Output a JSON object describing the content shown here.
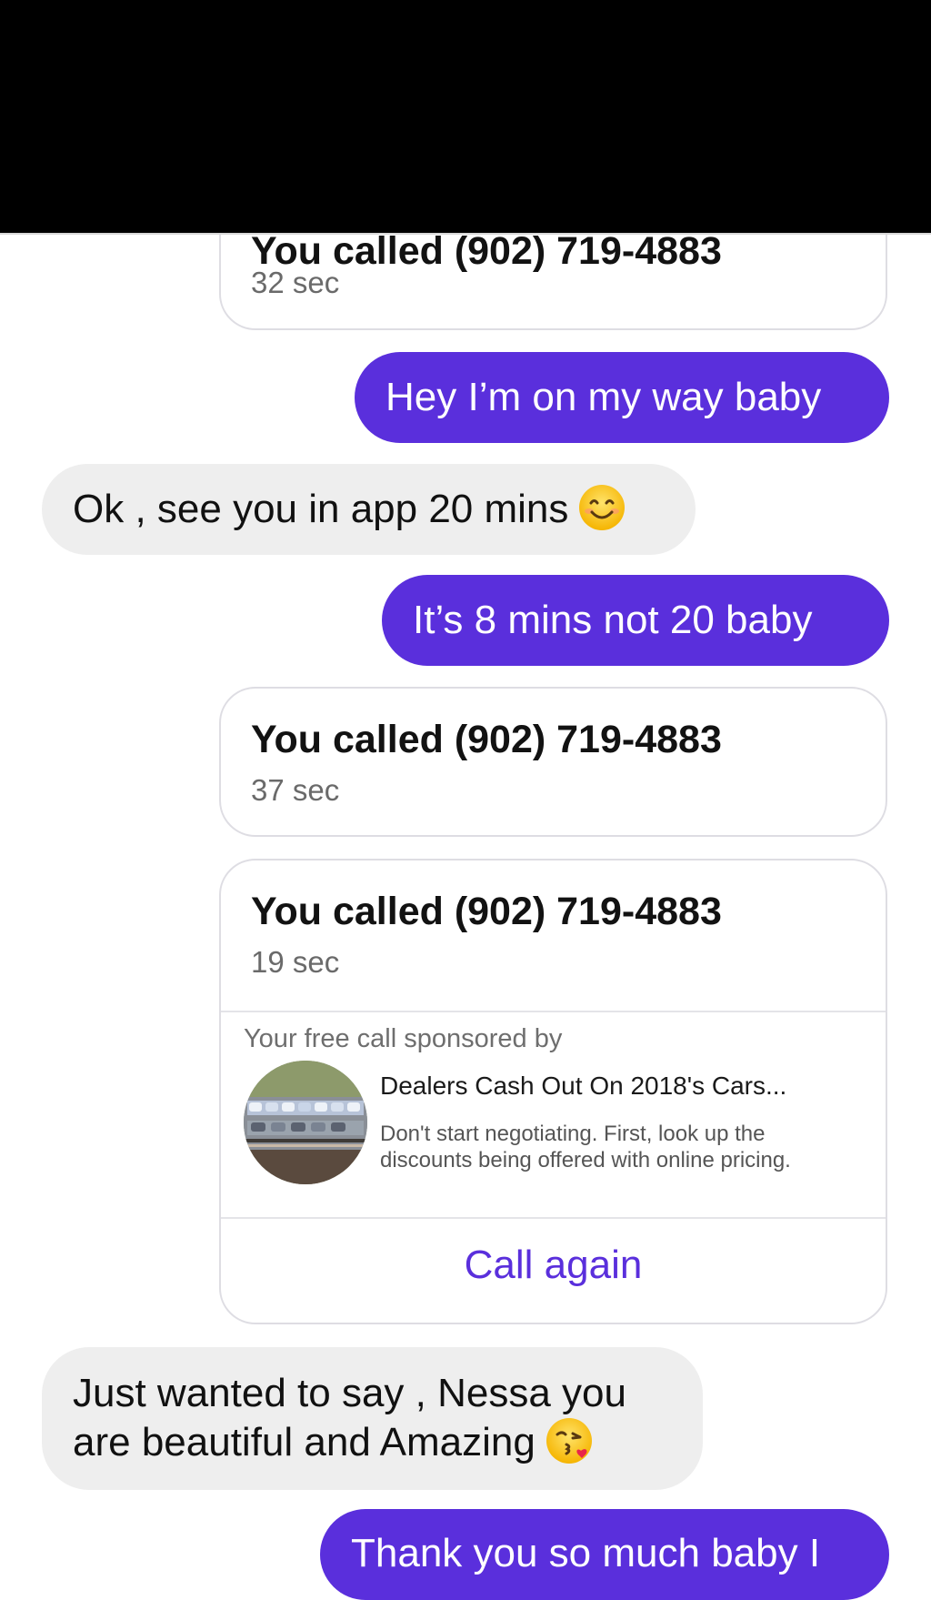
{
  "calls": [
    {
      "title": "You called (902) 719-4883",
      "duration": "32 sec"
    },
    {
      "title": "You called (902) 719-4883",
      "duration": "37 sec"
    },
    {
      "title": "You called (902) 719-4883",
      "duration": "19 sec"
    }
  ],
  "messages": [
    {
      "direction": "sent",
      "text": "Hey I’m on my way baby"
    },
    {
      "direction": "received",
      "text": "Ok , see you in app 20 mins",
      "emoji": "smiling-face-icon"
    },
    {
      "direction": "sent",
      "text": "It’s 8 mins not 20 baby"
    },
    {
      "direction": "received",
      "line1": "Just wanted to say , Nessa you",
      "line2": "are beautiful and Amazing",
      "emoji": "kissing-face-icon"
    },
    {
      "direction": "sent",
      "text": "Thank you so much baby I"
    }
  ],
  "sponsor": {
    "label": "Your free call sponsored by",
    "ad_title": "Dealers Cash Out On 2018's Cars...",
    "ad_description": "Don't start negotiating. First, look up the discounts being offered with online pricing.",
    "ad_image": "car-carrier-thumbnail"
  },
  "call_again_label": "Call again",
  "colors": {
    "sent_bubble": "#5a2fdc",
    "received_bubble": "#eeeeee",
    "accent": "#5a2fdc",
    "card_border": "#dedde3"
  }
}
